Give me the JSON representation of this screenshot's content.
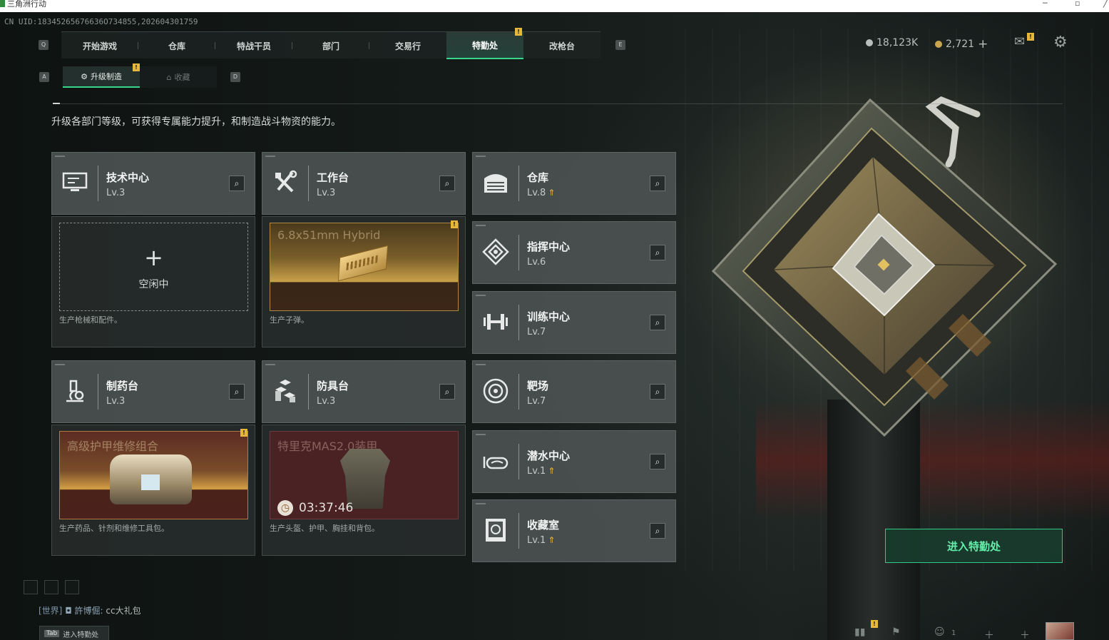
{
  "window": {
    "title": "三角洲行动"
  },
  "uid": "CN UID:18345265676636O734855,202604301759",
  "main_nav": {
    "key_left": "Q",
    "key_right": "E",
    "tabs": [
      {
        "label": "开始游戏",
        "active": false
      },
      {
        "label": "仓库",
        "active": false
      },
      {
        "label": "特战干员",
        "active": false
      },
      {
        "label": "部门",
        "active": false
      },
      {
        "label": "交易行",
        "active": false
      },
      {
        "label": "特勤处",
        "active": true,
        "badge": "!"
      },
      {
        "label": "改枪台",
        "active": false
      }
    ]
  },
  "sub_nav": {
    "key_left": "A",
    "key_right": "D",
    "tabs": [
      {
        "label": "升级制造",
        "active": true,
        "badge": "!"
      },
      {
        "label": "收藏",
        "active": false
      }
    ]
  },
  "currency": {
    "silver": "18,123K",
    "gold": "2,721",
    "gold_add": "+"
  },
  "mail_badge": "!",
  "intro": "升级各部门等级，可获得专属能力提升，和制造战斗物资的能力。",
  "departments": [
    {
      "name": "技术中心",
      "level": "Lv.3",
      "upgradable": false,
      "icon": "monitor-icon"
    },
    {
      "name": "工作台",
      "level": "Lv.3",
      "upgradable": false,
      "icon": "tools-icon"
    },
    {
      "name": "仓库",
      "level": "Lv.8",
      "upgradable": true,
      "icon": "warehouse-icon"
    },
    {
      "name": "指挥中心",
      "level": "Lv.6",
      "upgradable": false,
      "icon": "command-icon"
    },
    {
      "name": "训练中心",
      "level": "Lv.7",
      "upgradable": false,
      "icon": "dumbbell-icon"
    },
    {
      "name": "制药台",
      "level": "Lv.3",
      "upgradable": false,
      "icon": "microscope-icon"
    },
    {
      "name": "防具台",
      "level": "Lv.3",
      "upgradable": false,
      "icon": "armor-icon"
    },
    {
      "name": "靶场",
      "level": "Lv.7",
      "upgradable": false,
      "icon": "target-icon"
    },
    {
      "name": "潜水中心",
      "level": "Lv.1",
      "upgradable": true,
      "icon": "goggles-icon"
    },
    {
      "name": "收藏室",
      "level": "Lv.1",
      "upgradable": true,
      "icon": "trophy-icon"
    }
  ],
  "production": {
    "tech": {
      "state": "空闲中",
      "plus": "+",
      "desc": "生产枪械和配件。"
    },
    "workbench": {
      "item": "6.8x51mm Hybrid",
      "badge": "!",
      "desc": "生产子弹。"
    },
    "pharmacy": {
      "item": "高级护甲维修组合",
      "badge": "!",
      "desc": "生产药品、针剂和维修工具包。"
    },
    "armory": {
      "item": "特里克MAS2.0装甲",
      "timer": "03:37:46",
      "desc": "生产头盔、护甲、胸挂和背包。"
    }
  },
  "enter_button": "进入特勤处",
  "chat": {
    "channel": "[世界]",
    "sender": "許博倔:",
    "message": "cc大礼包"
  },
  "tab_hint": {
    "key": "Tab",
    "label": "进入特勤处"
  },
  "bottom_badge": "!",
  "bottom_count": "1",
  "colors": {
    "accent_green": "#38d68c",
    "badge_yellow": "#e7b73a",
    "card_bg": "#4e5454",
    "upgrade_gold": "#e6b54a"
  }
}
